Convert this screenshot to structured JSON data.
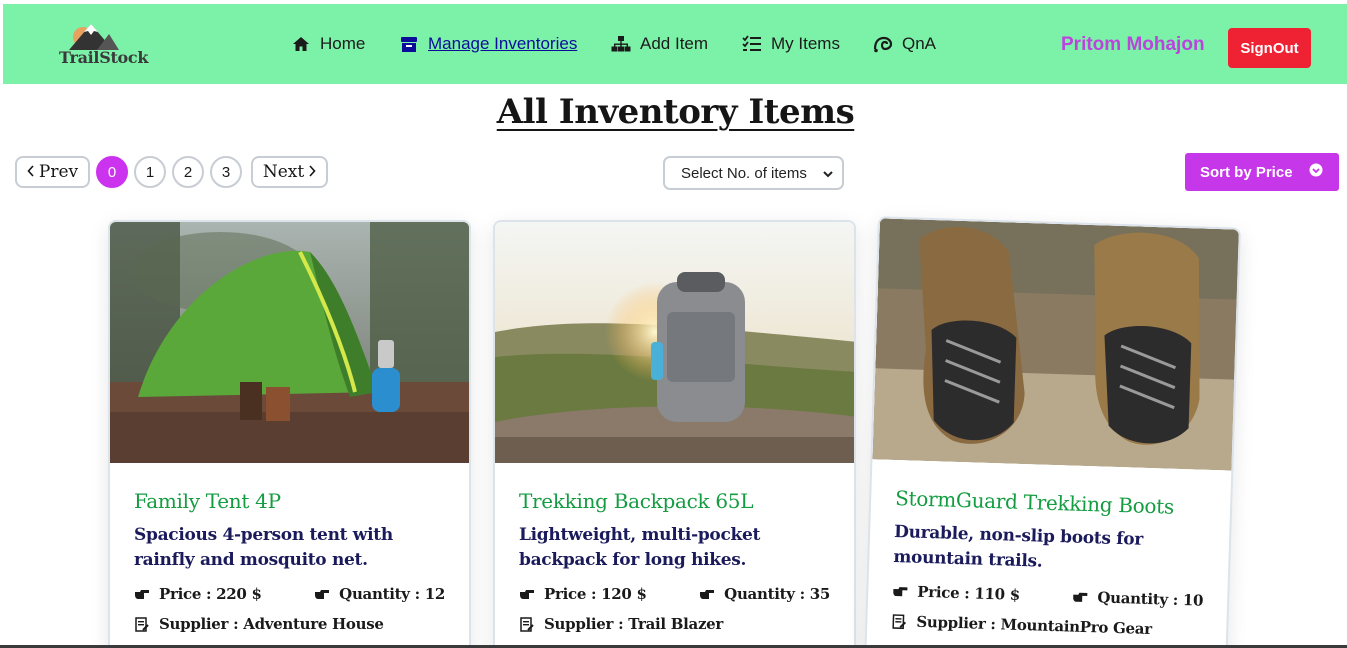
{
  "brand": {
    "name": "TrailStock"
  },
  "nav": {
    "items": [
      {
        "label": "Home",
        "icon": "home-icon"
      },
      {
        "label": "Manage Inventories",
        "icon": "archive-box-icon",
        "active": true
      },
      {
        "label": "Add Item",
        "icon": "sitemap-icon"
      },
      {
        "label": "My Items",
        "icon": "list-check-icon"
      },
      {
        "label": "QnA",
        "icon": "question-icon"
      }
    ],
    "user_name": "Pritom Mohajon",
    "signout_label": "SignOut"
  },
  "page": {
    "title": "All Inventory Items"
  },
  "pagination": {
    "prev_label": "Prev",
    "next_label": "Next",
    "pages": [
      "0",
      "1",
      "2",
      "3"
    ],
    "current": "0"
  },
  "items_select": {
    "selected": "Select No. of items"
  },
  "sort": {
    "label": "Sort by Price"
  },
  "items": [
    {
      "title": "Family Tent 4P",
      "description": "Spacious 4-person tent with rainfly and mosquito net.",
      "price": "Price : 220 $",
      "quantity": "Quantity : 12",
      "supplier": "Supplier : Adventure House"
    },
    {
      "title": "Trekking Backpack 65L",
      "description": "Lightweight, multi-pocket backpack for long hikes.",
      "price": "Price : 120 $",
      "quantity": "Quantity : 35",
      "supplier": "Supplier : Trail Blazer"
    },
    {
      "title": "StormGuard Trekking Boots",
      "description": "Durable, non-slip boots for mountain trails.",
      "price": "Price : 110 $",
      "quantity": "Quantity : 10",
      "supplier": "Supplier : MountainPro Gear"
    }
  ],
  "colors": {
    "navbar": "#7cf2a9",
    "accent_purple": "#c737ea",
    "signout_red": "#ee2233",
    "item_title_green": "#149c41",
    "desc_navy": "#1b1b5c"
  }
}
